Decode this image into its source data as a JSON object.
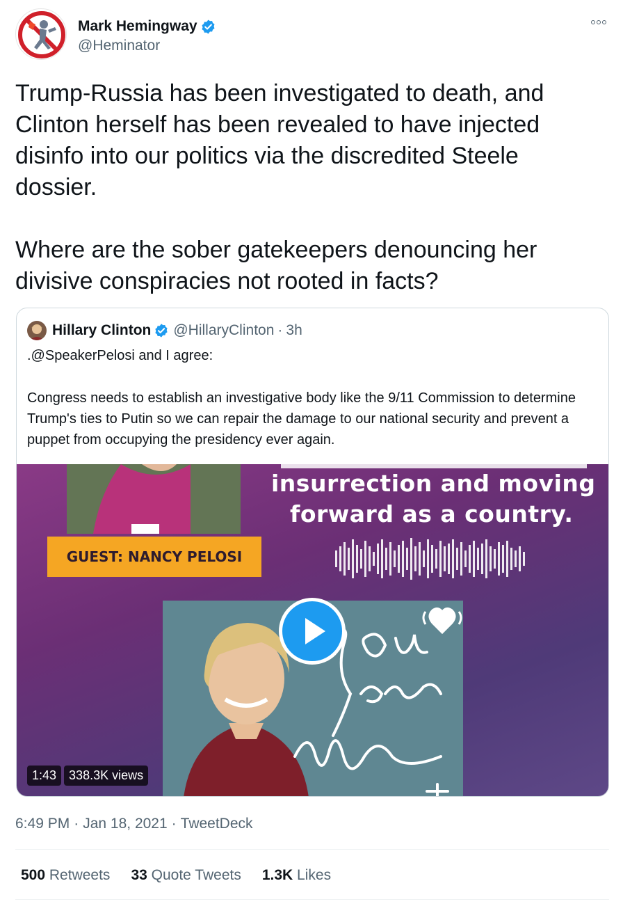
{
  "author": {
    "name": "Mark Hemingway",
    "handle": "@Heminator"
  },
  "tweet": {
    "text": "Trump-Russia has been investigated to death, and\nClinton herself has been revealed to have injected\ndisinfo into our politics via the discredited Steele\ndossier.\n\nWhere are the sober gatekeepers denouncing her\ndivisive conspiracies not rooted in facts?"
  },
  "quote": {
    "name": "Hillary Clinton",
    "handle": "@HillaryClinton",
    "dot": "·",
    "time": "3h",
    "line1": ".@SpeakerPelosi and I agree:",
    "body": "Congress needs to establish an investigative body like the 9/11 Commission to determine Trump's ties to Putin so we can repair the damage to our national security and prevent a puppet from occupying the presidency ever again."
  },
  "media": {
    "headline_line1": "insurrection and moving",
    "headline_line2": "forward as a country.",
    "guest_label": "GUEST: NANCY PELOSI",
    "duration": "1:43",
    "views": "338.3K views"
  },
  "meta": {
    "time": "6:49 PM",
    "sep1": "·",
    "date": "Jan 18, 2021",
    "sep2": "·",
    "source": "TweetDeck"
  },
  "stats": {
    "retweets_num": "500",
    "retweets_label": "Retweets",
    "quotes_num": "33",
    "quotes_label": "Quote Tweets",
    "likes_num": "1.3K",
    "likes_label": "Likes"
  },
  "colors": {
    "verified_blue": "#1d9bf0",
    "text_primary": "#0f1419",
    "text_secondary": "#536471",
    "guest_box": "#f5a623"
  }
}
